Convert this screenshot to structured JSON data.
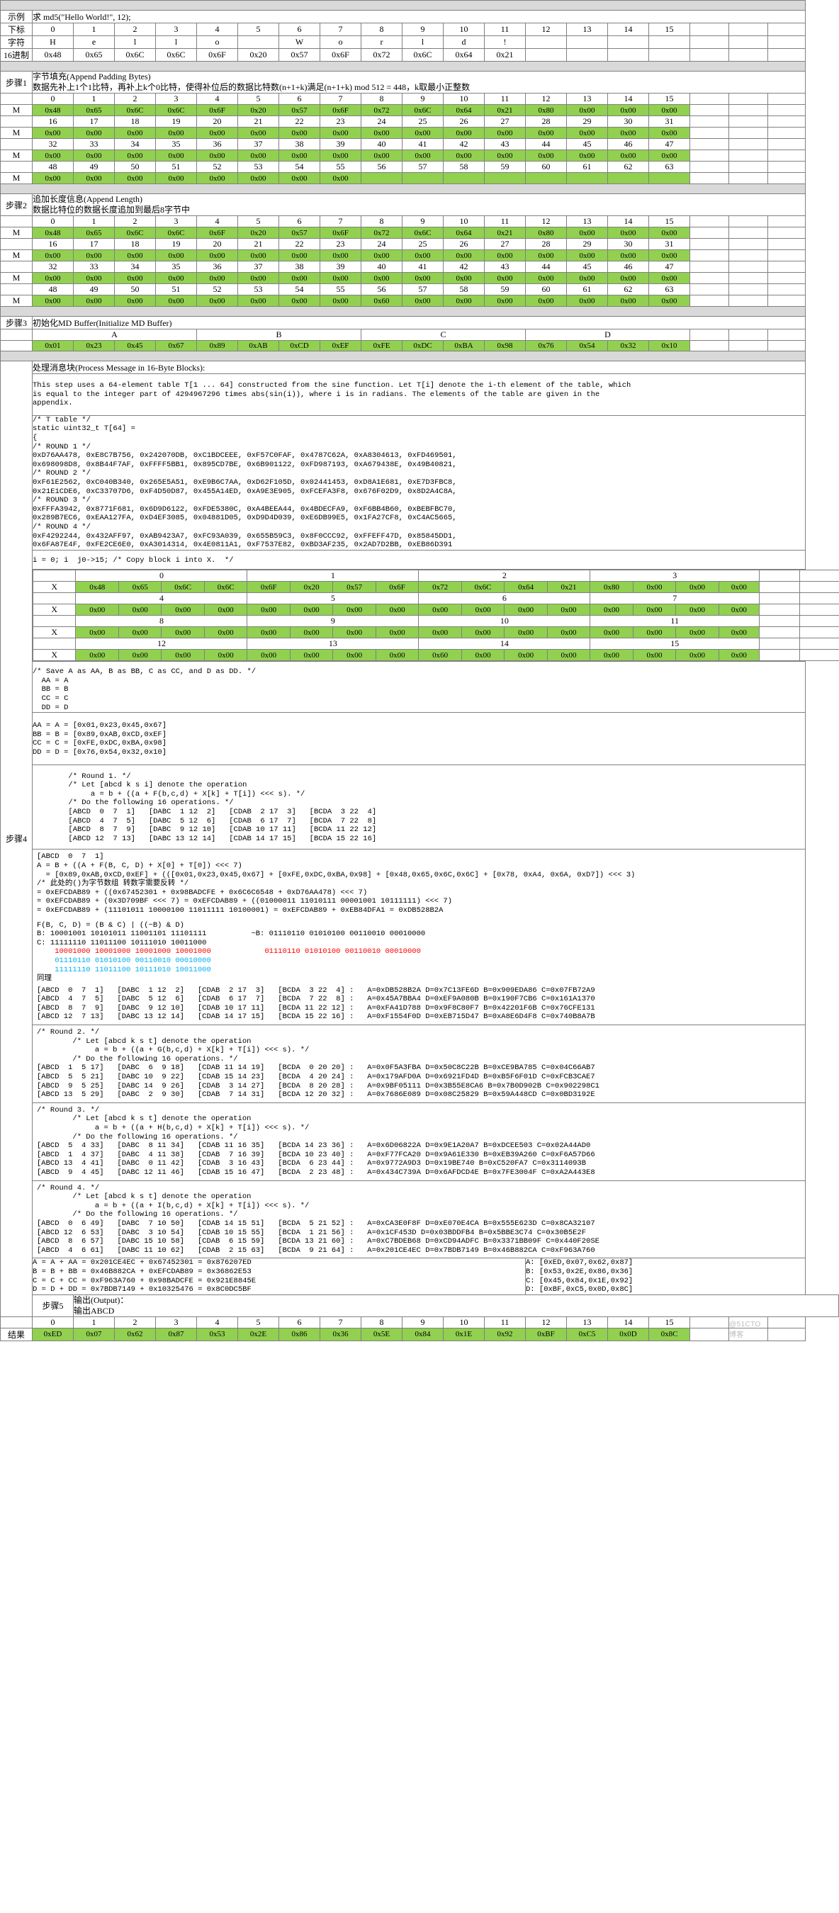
{
  "meta": {
    "watermark": "@51CTO博客",
    "green": "#92d050",
    "band": "#d9d9d9"
  },
  "example": {
    "label": "示例",
    "value": "求 md5(\"Hello World!\", 12);"
  },
  "charset": {
    "index_label": "下标",
    "char_label": "字符",
    "hex_label": "16进制",
    "indices": [
      "0",
      "1",
      "2",
      "3",
      "4",
      "5",
      "6",
      "7",
      "8",
      "9",
      "10",
      "11",
      "12",
      "13",
      "14",
      "15"
    ],
    "chars": [
      "H",
      "e",
      "l",
      "l",
      "o",
      " ",
      "W",
      "o",
      "r",
      "l",
      "d",
      "!",
      "",
      "",
      "",
      ""
    ],
    "hex": [
      "0x48",
      "0x65",
      "0x6C",
      "0x6C",
      "0x6F",
      "0x20",
      "0x57",
      "0x6F",
      "0x72",
      "0x6C",
      "0x64",
      "0x21",
      "",
      "",
      "",
      ""
    ]
  },
  "step1": {
    "name": "步骤1",
    "title": "字节填充(Append Padding Bytes)",
    "desc": "数据先补上1个1比特，再补上k个0比特，使得补位后的数据比特数(n+1+k)满足(n+1+k) mod 512 = 448，k取最小正整数",
    "row_label": "M",
    "index_rows": [
      [
        "0",
        "1",
        "2",
        "3",
        "4",
        "5",
        "6",
        "7",
        "8",
        "9",
        "10",
        "11",
        "12",
        "13",
        "14",
        "15"
      ],
      [
        "16",
        "17",
        "18",
        "19",
        "20",
        "21",
        "22",
        "23",
        "24",
        "25",
        "26",
        "27",
        "28",
        "29",
        "30",
        "31"
      ],
      [
        "32",
        "33",
        "34",
        "35",
        "36",
        "37",
        "38",
        "39",
        "40",
        "41",
        "42",
        "43",
        "44",
        "45",
        "46",
        "47"
      ],
      [
        "48",
        "49",
        "50",
        "51",
        "52",
        "53",
        "54",
        "55",
        "56",
        "57",
        "58",
        "59",
        "60",
        "61",
        "62",
        "63"
      ]
    ],
    "data_rows": [
      [
        "0x48",
        "0x65",
        "0x6C",
        "0x6C",
        "0x6F",
        "0x20",
        "0x57",
        "0x6F",
        "0x72",
        "0x6C",
        "0x64",
        "0x21",
        "0x80",
        "0x00",
        "0x00",
        "0x00"
      ],
      [
        "0x00",
        "0x00",
        "0x00",
        "0x00",
        "0x00",
        "0x00",
        "0x00",
        "0x00",
        "0x00",
        "0x00",
        "0x00",
        "0x00",
        "0x00",
        "0x00",
        "0x00",
        "0x00"
      ],
      [
        "0x00",
        "0x00",
        "0x00",
        "0x00",
        "0x00",
        "0x00",
        "0x00",
        "0x00",
        "0x00",
        "0x00",
        "0x00",
        "0x00",
        "0x00",
        "0x00",
        "0x00",
        "0x00"
      ],
      [
        "0x00",
        "0x00",
        "0x00",
        "0x00",
        "0x00",
        "0x00",
        "0x00",
        "0x00",
        "",
        "",
        "",
        "",
        "",
        "",
        "",
        ""
      ]
    ]
  },
  "step2": {
    "name": "步骤2",
    "title": "追加长度信息(Append Length)",
    "desc": "数据比特位的数据长度追加到最后8字节中",
    "row_label": "M",
    "index_rows": [
      [
        "0",
        "1",
        "2",
        "3",
        "4",
        "5",
        "6",
        "7",
        "8",
        "9",
        "10",
        "11",
        "12",
        "13",
        "14",
        "15"
      ],
      [
        "16",
        "17",
        "18",
        "19",
        "20",
        "21",
        "22",
        "23",
        "24",
        "25",
        "26",
        "27",
        "28",
        "29",
        "30",
        "31"
      ],
      [
        "32",
        "33",
        "34",
        "35",
        "36",
        "37",
        "38",
        "39",
        "40",
        "41",
        "42",
        "43",
        "44",
        "45",
        "46",
        "47"
      ],
      [
        "48",
        "49",
        "50",
        "51",
        "52",
        "53",
        "54",
        "55",
        "56",
        "57",
        "58",
        "59",
        "60",
        "61",
        "62",
        "63"
      ]
    ],
    "data_rows": [
      [
        "0x48",
        "0x65",
        "0x6C",
        "0x6C",
        "0x6F",
        "0x20",
        "0x57",
        "0x6F",
        "0x72",
        "0x6C",
        "0x64",
        "0x21",
        "0x80",
        "0x00",
        "0x00",
        "0x00"
      ],
      [
        "0x00",
        "0x00",
        "0x00",
        "0x00",
        "0x00",
        "0x00",
        "0x00",
        "0x00",
        "0x00",
        "0x00",
        "0x00",
        "0x00",
        "0x00",
        "0x00",
        "0x00",
        "0x00"
      ],
      [
        "0x00",
        "0x00",
        "0x00",
        "0x00",
        "0x00",
        "0x00",
        "0x00",
        "0x00",
        "0x00",
        "0x00",
        "0x00",
        "0x00",
        "0x00",
        "0x00",
        "0x00",
        "0x00"
      ],
      [
        "0x00",
        "0x00",
        "0x00",
        "0x00",
        "0x00",
        "0x00",
        "0x00",
        "0x00",
        "0x60",
        "0x00",
        "0x00",
        "0x00",
        "0x00",
        "0x00",
        "0x00",
        "0x00"
      ]
    ]
  },
  "step3": {
    "name": "步骤3",
    "title": "初始化MD Buffer(Initialize MD Buffer)",
    "segments": [
      "A",
      "B",
      "C",
      "D"
    ],
    "values": [
      "0x01",
      "0x23",
      "0x45",
      "0x67",
      "0x89",
      "0xAB",
      "0xCD",
      "0xEF",
      "0xFE",
      "0xDC",
      "0xBA",
      "0x98",
      "0x76",
      "0x54",
      "0x32",
      "0x10"
    ]
  },
  "step4": {
    "name": "步骤4",
    "title": "处理消息块(Process Message in 16-Byte Blocks):",
    "intro": "This step uses a 64-element table T[1 ... 64] constructed from the sine function. Let T[i] denote the i-th element of the table, which\nis equal to the integer part of 4294967296 times abs(sin(i)), where i is in radians. The elements of the table are given in the\nappendix.",
    "ttable": "/* T table */\nstatic uint32_t T[64] =\n{\n/* ROUND 1 */\n0xD76AA478, 0xE8C7B756, 0x242070DB, 0xC1BDCEEE, 0xF57C0FAF, 0x4787C62A, 0xA8304613, 0xFD469501,\n0x698098D8, 0x8B44F7AF, 0xFFFF5BB1, 0x895CD7BE, 0x6B901122, 0xFD987193, 0xA679438E, 0x49B40821,\n/* ROUND 2 */\n0xF61E2562, 0xC040B340, 0x265E5A51, 0xE9B6C7AA, 0xD62F105D, 0x02441453, 0xD8A1E681, 0xE7D3FBC8,\n0x21E1CDE6, 0xC33707D6, 0xF4D50D87, 0x455A14ED, 0xA9E3E905, 0xFCEFA3F8, 0x676F02D9, 0x8D2A4C8A,\n/* ROUND 3 */\n0xFFFA3942, 0x8771F681, 0x6D9D6122, 0xFDE5380C, 0xA4BEEA44, 0x4BDECFA9, 0xF6BB4B60, 0xBEBFBC70,\n0x289B7EC6, 0xEAA127FA, 0xD4EF3085, 0x04881D05, 0xD9D4D039, 0xE6DB99E5, 0x1FA27CF8, 0xC4AC5665,\n/* ROUND 4 */\n0xF4292244, 0x432AFF97, 0xAB9423A7, 0xFC93A039, 0x655B59C3, 0x8F0CCC92, 0xFFEFF47D, 0x85845DD1,\n0x6FA87E4F, 0xFE2CE6E0, 0xA3014314, 0x4E0811A1, 0xF7537E82, 0xBD3AF235, 0x2AD7D2BB, 0xEB86D391",
    "copy_comment": "i = 0; i  j0->15; /* Copy block i into X.  */",
    "x_label": "X",
    "x_groups": [
      {
        "headers": [
          "0",
          "1",
          "2",
          "3"
        ],
        "values": [
          "0x48",
          "0x65",
          "0x6C",
          "0x6C",
          "0x6F",
          "0x20",
          "0x57",
          "0x6F",
          "0x72",
          "0x6C",
          "0x64",
          "0x21",
          "0x80",
          "0x00",
          "0x00",
          "0x00"
        ]
      },
      {
        "headers": [
          "4",
          "5",
          "6",
          "7"
        ],
        "values": [
          "0x00",
          "0x00",
          "0x00",
          "0x00",
          "0x00",
          "0x00",
          "0x00",
          "0x00",
          "0x00",
          "0x00",
          "0x00",
          "0x00",
          "0x00",
          "0x00",
          "0x00",
          "0x00"
        ]
      },
      {
        "headers": [
          "8",
          "9",
          "10",
          "11"
        ],
        "values": [
          "0x00",
          "0x00",
          "0x00",
          "0x00",
          "0x00",
          "0x00",
          "0x00",
          "0x00",
          "0x00",
          "0x00",
          "0x00",
          "0x00",
          "0x00",
          "0x00",
          "0x00",
          "0x00"
        ]
      },
      {
        "headers": [
          "12",
          "13",
          "14",
          "15"
        ],
        "values": [
          "0x00",
          "0x00",
          "0x00",
          "0x00",
          "0x00",
          "0x00",
          "0x00",
          "0x00",
          "0x60",
          "0x00",
          "0x00",
          "0x00",
          "0x00",
          "0x00",
          "0x00",
          "0x00"
        ]
      }
    ],
    "save_block": "/* Save A as AA, B as BB, C as CC, and D as DD. */\n  AA = A\n  BB = B\n  CC = C\n  DD = D",
    "save_values": "AA = A = [0x01,0x23,0x45,0x67]\nBB = B = [0x89,0xAB,0xCD,0xEF]\nCC = C = [0xFE,0xDC,0xBA,0x98]\nDD = D = [0x76,0x54,0x32,0x10]",
    "round1_block": "        /* Round 1. */\n        /* Let [abcd k s i] denote the operation\n             a = b + ((a + F(b,c,d) + X[k] + T[i]) <<< s). */\n        /* Do the following 16 operations. */\n        [ABCD  0  7  1]   [DABC  1 12  2]   [CDAB  2 17  3]   [BCDA  3 22  4]\n        [ABCD  4  7  5]   [DABC  5 12  6]   [CDAB  6 17  7]   [BCDA  7 22  8]\n        [ABCD  8  7  9]   [DABC  9 12 10]   [CDAB 10 17 11]   [BCDA 11 22 12]\n        [ABCD 12  7 13]   [DABC 13 12 14]   [CDAB 14 17 15]   [BCDA 15 22 16]",
    "calc_abcd": "[ABCD  0  7  1]\nA = B + ((A + F(B, C, D) + X[0] + T[0]) <<< 7)\n  = [0x89,0xAB,0xCD,0xEF] + (([0x01,0x23,0x45,0x67] + [0xFE,0xDC,0xBA,0x98] + [0x48,0x65,0x6C,0x6C] + [0x78, 0xA4, 0x6A, 0xD7]) <<< 3)\n/* 此处的()为字节数组 转数字需要反转 */\n= 0xEFCDAB89 + ((0x67452301 + 0x98BADCFE + 0x6C6C6548 + 0xD76AA478) <<< 7)\n= 0xEFCDAB89 + (0x3D709BF <<< 7) = 0xEFCDAB89 + ((01000011 11010111 00001001 10111111) <<< 7)\n= 0xEFCDAB89 + (11101011 10000100 11011111 10100001) = 0xEFCDAB89 + 0xEB84DFA1 = 0xDB528B2A",
    "fbcd_lines": [
      "F(B, C, D) = (B & C) | ((~B) & D)",
      "B: 10001001 10101011 11001101 11101111          ~B: 01110110 01010100 00110010 00010000",
      "C: 11111110 11011100 10111010 10011000",
      "    10001000 10001000 10001000 10001000            01110110 01010100 00110010 00010000",
      "    01110110 01010100 00110010 00010000",
      "    11111110 11011100 10111010 10011000",
      "同理"
    ],
    "fbcd_red_index": 3,
    "round1_results": [
      "[ABCD  0  7  1]   [DABC  1 12  2]   [CDAB  2 17  3]   [BCDA  3 22  4] :   A=0xDB528B2A D=0x7C13FE6D B=0x909EDA86 C=0x07FB72A9",
      "[ABCD  4  7  5]   [DABC  5 12  6]   [CDAB  6 17  7]   [BCDA  7 22  8] :   A=0x45A7BBA4 D=0xEF9A080B B=0x190F7CB6 C=0x161A1370",
      "[ABCD  8  7  9]   [DABC  9 12 10]   [CDAB 10 17 11]   [BCDA 11 22 12] :   A=0xFA41D788 D=0x9F8C80F7 B=0x42201F6B C=0x76CFE131",
      "[ABCD 12  7 13]   [DABC 13 12 14]   [CDAB 14 17 15]   [BCDA 15 22 16] :   A=0xF1554F0D D=0xEB715D47 B=0xA8E6D4F8 C=0x740B8A7B"
    ],
    "round2_block": "/* Round 2. */\n        /* Let [abcd k s t] denote the operation\n             a = b + ((a + G(b,c,d) + X[k] + T[i]) <<< s). */\n        /* Do the following 16 operations. */",
    "round2_results": [
      "[ABCD  1  5 17]   [DABC  6  9 18]   [CDAB 11 14 19]   [BCDA  0 20 20] :   A=0x0F5A3FBA D=0x50C8C22B B=0xCE9BA785 C=0x04C66AB7",
      "[ABCD  5  5 21]   [DABC 10  9 22]   [CDAB 15 14 23]   [BCDA  4 20 24] :   A=0x179AFD0A D=0x6921FD4D B=0xB5F6F01D C=0xFCB3CAE7",
      "[ABCD  9  5 25]   [DABC 14  9 26]   [CDAB  3 14 27]   [BCDA  8 20 28] :   A=0x9BF05111 D=0x3B55E8CA6 B=0x7B0D902B C=0x902298C1",
      "[ABCD 13  5 29]   [DABC  2  9 30]   [CDAB  7 14 31]   [BCDA 12 20 32] :   A=0x7686E089 D=0x08C25829 B=0x59A448CD C=0x0BD3192E"
    ],
    "round3_block": "/* Round 3. */\n        /* Let [abcd k s t] denote the operation\n             a = b + ((a + H(b,c,d) + X[k] + T[i]) <<< s). */\n        /* Do the following 16 operations. */",
    "round3_results": [
      "[ABCD  5  4 33]   [DABC  8 11 34]   [CDAB 11 16 35]   [BCDA 14 23 36] :   A=0x6D06822A D=0x9E1A20A7 B=0xDCEE503 C=0x02A44AD0",
      "[ABCD  1  4 37]   [DABC  4 11 38]   [CDAB  7 16 39]   [BCDA 10 23 40] :   A=0xF77FCA20 D=0x9A61E330 B=0xEB39A260 C=0xF6A57D66",
      "[ABCD 13  4 41]   [DABC  0 11 42]   [CDAB  3 16 43]   [BCDA  6 23 44] :   A=0x9772A9D3 D=0x19BE740 B=0xC520FA7 C=0x3114093B",
      "[ABCD  9  4 45]   [DABC 12 11 46]   [CDAB 15 16 47]   [BCDA  2 23 48] :   A=0x434C739A D=0x6AFDCD4E B=0x7FE3004F C=0xA2A443E8"
    ],
    "round4_block": "/* Round 4. */\n        /* Let [abcd k s t] denote the operation\n             a = b + ((a + I(b,c,d) + X[k] + T[i]) <<< s). */\n        /* Do the following 16 operations. */",
    "round4_results": [
      "[ABCD  0  6 49]   [DABC  7 10 50]   [CDAB 14 15 51]   [BCDA  5 21 52] :   A=0xCA3E0F8F D=0xE070E4CA B=0x555E623D C=0x8CA32107",
      "[ABCD 12  6 53]   [DABC  3 10 54]   [CDAB 10 15 55]   [BCDA  1 21 56] :   A=0x1CF453D D=0x03BDDFB4 B=0x5BBE3C74 C=0x30B5E2F",
      "[ABCD  8  6 57]   [DABC 15 10 58]   [CDAB  6 15 59]   [BCDA 13 21 60] :   A=0xC7BDEB68 D=0xCD94ADFC B=0x3371BB09F C=0x440F20SE",
      "[ABCD  4  6 61]   [DABC 11 10 62]   [CDAB  2 15 63]   [BCDA  9 21 64] :   A=0x201CE4EC D=0x7BDB7149 B=0x46B882CA C=0xF963A760"
    ],
    "final_add_left": "A = A + AA = 0x201CE4EC + 0x67452301 = 0x876207ED\nB = B + BB = 0x46B882CA + 0xEFCDAB89 = 0x36862E53\nC = C + CC = 0xF963A760 + 0x98BADCFE = 0x921E8845E\nD = D + DD = 0x7BDB7149 + 0x10325476 = 0x8C0DC5BF",
    "final_add_right": "A: [0xED,0x07,0x62,0x87]\nB: [0x53,0x2E,0x86,0x36]\nC: [0x45,0x84,0x1E,0x92]\nD: [0xBF,0xC5,0x0D,0x8C]"
  },
  "step5": {
    "name": "步骤5",
    "title": "输出(Output)：",
    "subtitle": "输出ABCD",
    "result_label": "结果",
    "indices": [
      "0",
      "1",
      "2",
      "3",
      "4",
      "5",
      "6",
      "7",
      "8",
      "9",
      "10",
      "11",
      "12",
      "13",
      "14",
      "15"
    ],
    "values": [
      "0xED",
      "0x07",
      "0x62",
      "0x87",
      "0x53",
      "0x2E",
      "0x86",
      "0x36",
      "0x5E",
      "0x84",
      "0x1E",
      "0x92",
      "0xBF",
      "0xC5",
      "0x0D",
      "0x8C"
    ]
  }
}
